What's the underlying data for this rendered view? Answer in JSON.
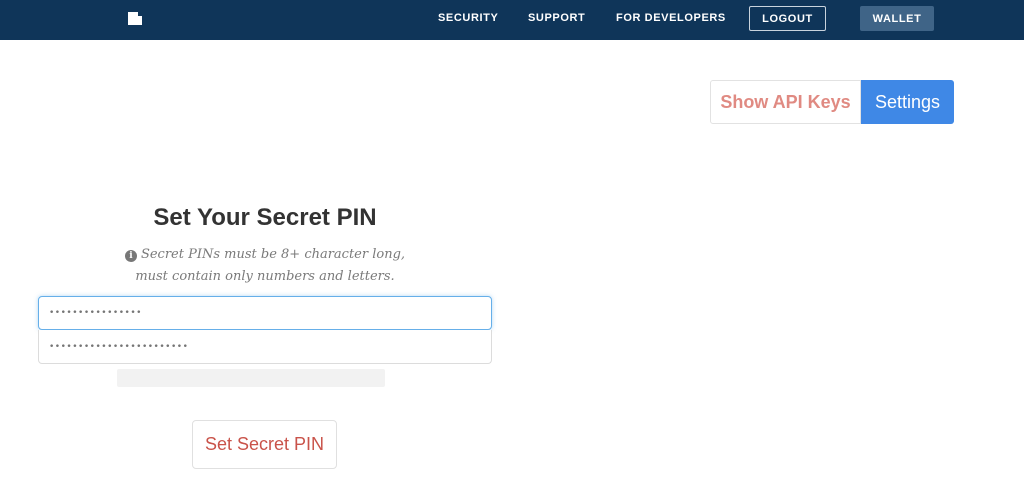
{
  "nav": {
    "security": "SECURITY",
    "support": "SUPPORT",
    "developers": "FOR DEVELOPERS",
    "logout": "LOGOUT",
    "wallet": "WALLET"
  },
  "actions": {
    "api_keys": "Show API Keys",
    "settings": "Settings"
  },
  "pin_form": {
    "title": "Set Your Secret PIN",
    "hint_line1": "Secret PINs must be 8+ character long,",
    "hint_line2": "must contain only numbers and letters.",
    "pin_placeholder": "••••••••••••••••",
    "confirm_placeholder": "••••••••••••••••••••••••",
    "submit": "Set Secret PIN"
  },
  "colors": {
    "navbar": "#0f3559",
    "wallet_button": "#3f6487",
    "settings_button": "#3f88e6",
    "api_keys_text": "#e08a82",
    "submit_text": "#c9534a",
    "focus_border": "#66afe9"
  },
  "icons": {
    "logo": "document-icon",
    "hint": "info-circle-icon"
  }
}
